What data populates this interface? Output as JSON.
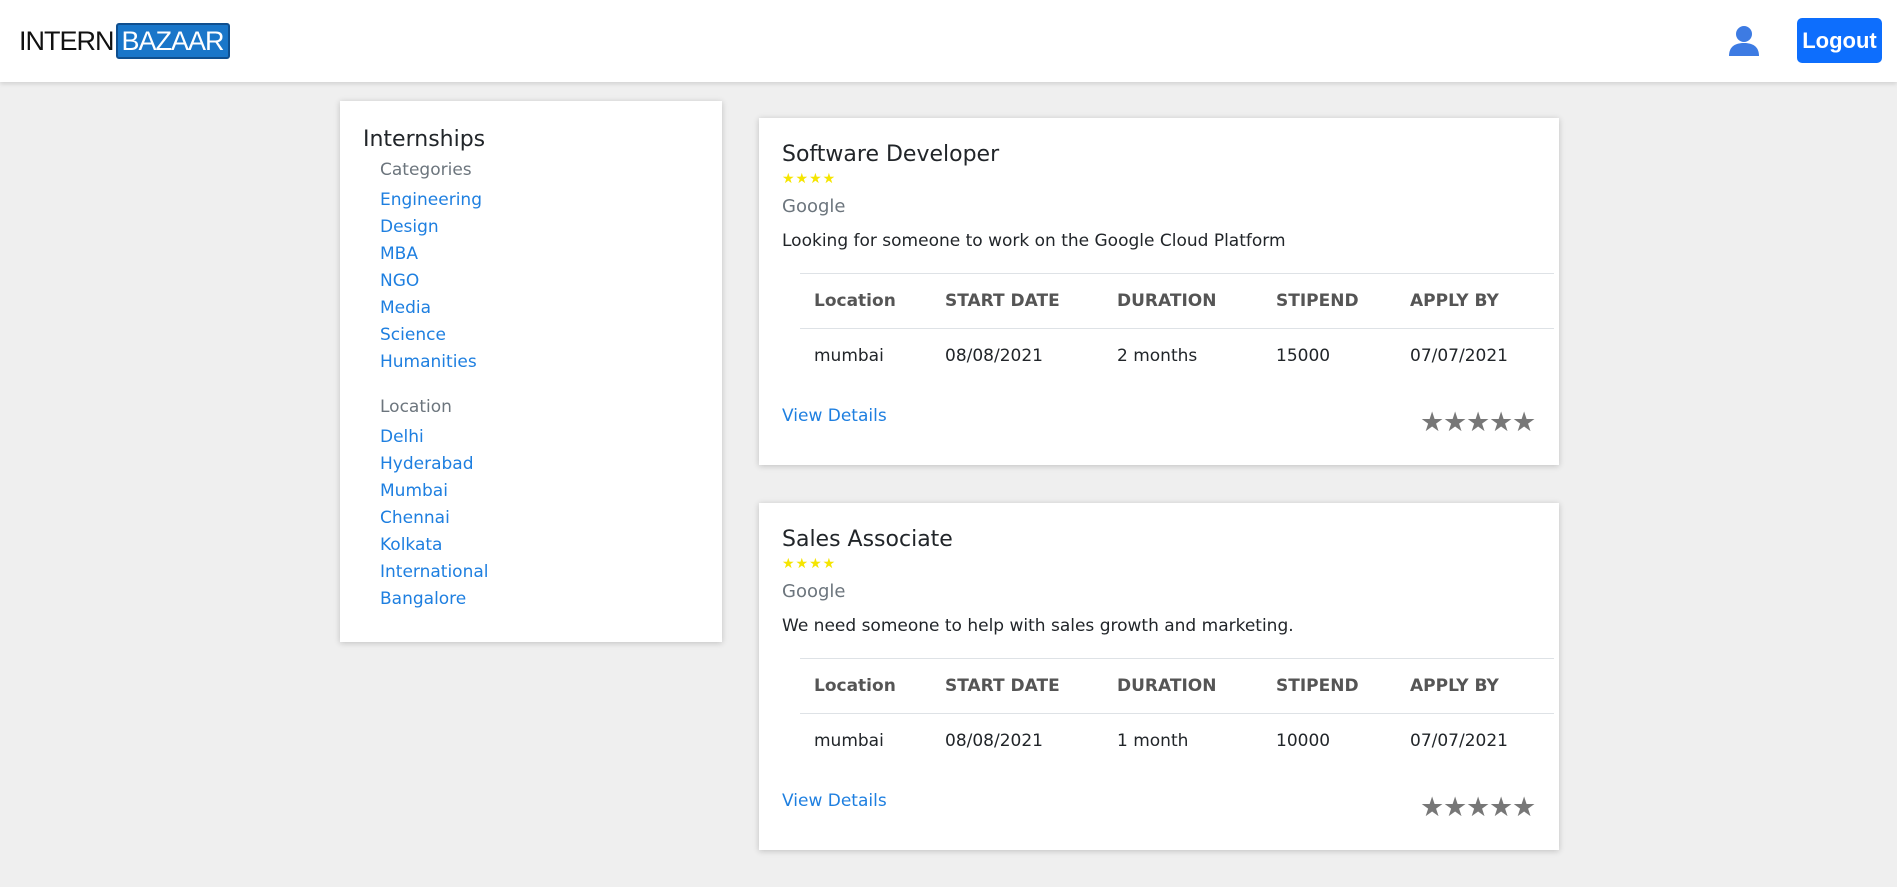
{
  "header": {
    "logo_left": "INTERN",
    "logo_right": "BAZAAR",
    "logout_label": "Logout",
    "accent_color": "#0d6efd"
  },
  "sidebar": {
    "title": "Internships",
    "categories_heading": "Categories",
    "categories": [
      "Engineering",
      "Design",
      "MBA",
      "NGO",
      "Media",
      "Science",
      "Humanities"
    ],
    "location_heading": "Location",
    "locations": [
      "Delhi",
      "Hyderabad",
      "Mumbai",
      "Chennai",
      "Kolkata",
      "International",
      "Bangalore"
    ]
  },
  "table_headers": [
    "Location",
    "START DATE",
    "DURATION",
    "STIPEND",
    "APPLY BY"
  ],
  "internships": [
    {
      "title": "Software Developer",
      "stars": "★★★★",
      "company": "Google",
      "description": "Looking for someone to work on the Google Cloud Platform",
      "location": "mumbai",
      "start_date": "08/08/2021",
      "duration": "2 months",
      "stipend": "15000",
      "apply_by": "07/07/2021",
      "view_details": "View Details",
      "rate_stars": [
        "★",
        "★",
        "★",
        "★",
        "★"
      ]
    },
    {
      "title": "Sales Associate",
      "stars": "★★★★",
      "company": "Google",
      "description": "We need someone to help with sales growth and marketing.",
      "location": "mumbai",
      "start_date": "08/08/2021",
      "duration": "1 month",
      "stipend": "10000",
      "apply_by": "07/07/2021",
      "view_details": "View Details",
      "rate_stars": [
        "★",
        "★",
        "★",
        "★",
        "★"
      ]
    }
  ]
}
